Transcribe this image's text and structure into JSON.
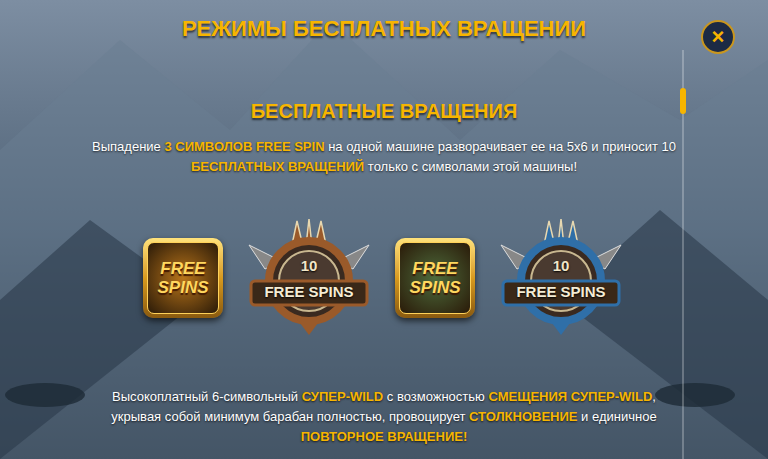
{
  "title": "РЕЖИМЫ БЕСПЛАТНЫХ ВРАЩЕНИИ",
  "close_button": "×",
  "scroll": {
    "level": 0.1
  },
  "section": {
    "title": "БЕСПЛАТНЫЕ ВРАЩЕНИЯ",
    "intro": [
      {
        "text": "Выпадение ",
        "highlight": false
      },
      {
        "text": "3 СИМВОЛОВ FREE SPIN",
        "highlight": true
      },
      {
        "text": " на одной машине разворачивает ее на 5x6 и приносит 10 ",
        "highlight": false
      },
      {
        "text": "БЕСПЛАТНЫХ ВРАЩЕНИЙ",
        "highlight": true
      },
      {
        "text": " только с символами этой машины!",
        "highlight": false
      }
    ],
    "symbols": [
      {
        "kind": "symbol",
        "lines": [
          "FREE",
          "SPINS"
        ],
        "color": "#b8741a"
      },
      {
        "kind": "shield",
        "lines": [
          "10",
          "FREE SPINS"
        ],
        "color": "#9a5a2a"
      },
      {
        "kind": "symbol",
        "lines": [
          "FREE",
          "SPINS"
        ],
        "color": "#4d6b3c"
      },
      {
        "kind": "shield",
        "lines": [
          "10",
          "FREE SPINS"
        ],
        "color": "#2f6fa8"
      }
    ],
    "description": [
      {
        "text": "Высокоплатный 6-символьный ",
        "highlight": false
      },
      {
        "text": "СУПЕР-WILD",
        "highlight": true
      },
      {
        "text": " с возможностью ",
        "highlight": false
      },
      {
        "text": "СМЕЩЕНИЯ СУПЕР-WILD",
        "highlight": true
      },
      {
        "text": ", укрывая собой минимум барабан полностью, провоцирует ",
        "highlight": false
      },
      {
        "text": "СТОЛКНОВЕНИЕ",
        "highlight": true
      },
      {
        "text": " и единичное ",
        "highlight": false
      },
      {
        "text": "ПОВТОРНОЕ ВРАЩЕНИЕ!",
        "highlight": true
      }
    ]
  }
}
